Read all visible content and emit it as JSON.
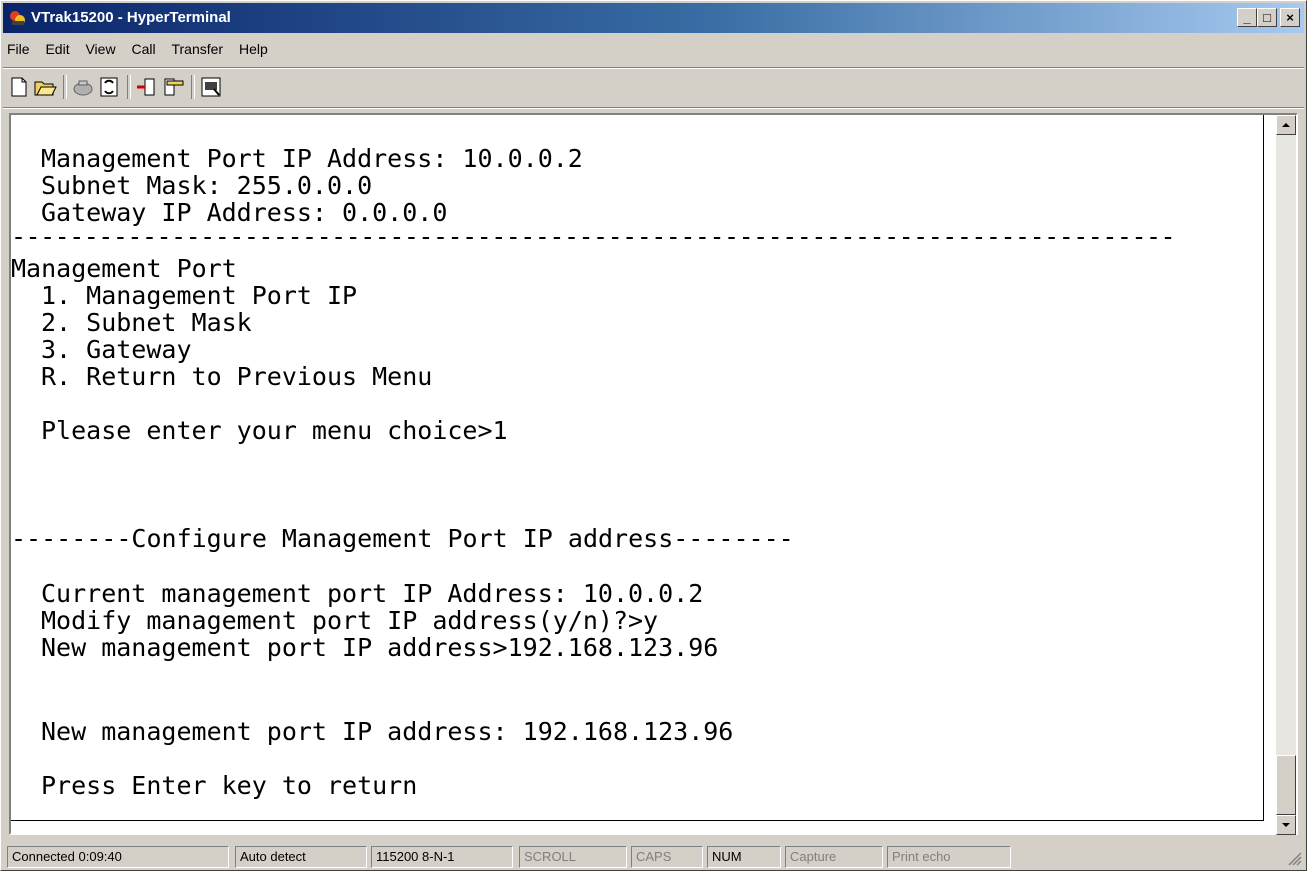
{
  "window": {
    "title": "VTrak15200 - HyperTerminal",
    "minimize_glyph": "_",
    "maximize_glyph": "□",
    "close_glyph": "×"
  },
  "menu": {
    "items": [
      {
        "label": "File"
      },
      {
        "label": "Edit"
      },
      {
        "label": "View"
      },
      {
        "label": "Call"
      },
      {
        "label": "Transfer"
      },
      {
        "label": "Help"
      }
    ]
  },
  "toolbar": {
    "buttons": [
      "new-icon",
      "open-icon",
      "disconnect-phone-icon",
      "call-icon",
      "send-icon",
      "receive-icon",
      "properties-icon"
    ]
  },
  "terminal": {
    "lines": [
      "Management Port IP Address: 10.0.0.2",
      "Subnet Mask: 255.0.0.0",
      "Gateway IP Address: 0.0.0.0",
      "--------------------------------------------------------------------------------",
      "Management Port",
      "1. Management Port IP",
      "2. Subnet Mask",
      "3. Gateway",
      "R. Return to Previous Menu",
      "Please enter your menu choice>1",
      "--------Configure Management Port IP address--------",
      "Current management port IP Address: 10.0.0.2",
      "Modify management port IP address(y/n)?>y",
      "New management port IP address>192.168.123.96",
      "New management port IP address: 192.168.123.96",
      "Press Enter key to return"
    ]
  },
  "statusbar": {
    "connected": "Connected 0:09:40",
    "detect": "Auto detect",
    "settings": "115200 8-N-1",
    "scroll": "SCROLL",
    "caps": "CAPS",
    "num": "NUM",
    "capture": "Capture",
    "print_echo": "Print echo"
  }
}
